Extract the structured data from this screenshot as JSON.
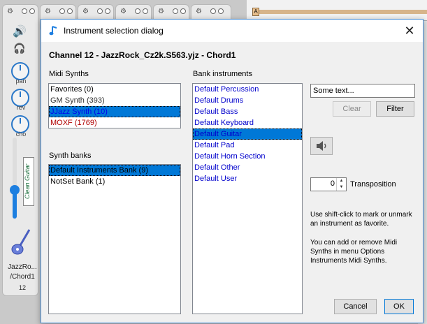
{
  "background": {
    "strip": {
      "pan_label": "pan",
      "rev_label": "rev",
      "cho_label": "cho",
      "vertical_label": "Clean Guitar",
      "name_line1": "JazzRo...",
      "name_line2": "/Chord1",
      "channel_number": "12"
    },
    "ruler_marker": "A"
  },
  "dialog": {
    "title": "Instrument selection dialog",
    "heading": "Channel 12 - JazzRock_Cz2k.S563.yjz - Chord1",
    "midi_synths_label": "Midi Synths",
    "midi_synths": [
      {
        "label": "Favorites (0)",
        "color": "#000000",
        "selected": false
      },
      {
        "label": "GM Synth (393)",
        "color": "#333333",
        "selected": false
      },
      {
        "label": "JJazz Synth (10)",
        "color": "#0000ee",
        "selected": true
      },
      {
        "label": "MOXF (1769)",
        "color": "#b00000",
        "selected": false
      }
    ],
    "synth_banks_label": "Synth banks",
    "synth_banks": [
      {
        "label": "Default Instruments Bank (9)",
        "selected": true
      },
      {
        "label": "NotSet Bank (1)",
        "selected": false
      }
    ],
    "bank_instruments_label": "Bank instruments",
    "bank_instruments": [
      {
        "label": "Default Percussion",
        "selected": false
      },
      {
        "label": "Default Drums",
        "selected": false
      },
      {
        "label": "Default Bass",
        "selected": false
      },
      {
        "label": "Default Keyboard",
        "selected": false
      },
      {
        "label": "Default Guitar",
        "selected": true
      },
      {
        "label": "Default Pad",
        "selected": false
      },
      {
        "label": "Default Horn Section",
        "selected": false
      },
      {
        "label": "Default Other",
        "selected": false
      },
      {
        "label": "Default User",
        "selected": false
      }
    ],
    "instrument_color": "#0000cc",
    "selection_color": "#0078d7",
    "search_value": "Some text...",
    "clear_label": "Clear",
    "filter_label": "Filter",
    "transposition_value": "0",
    "transposition_label": "Transposition",
    "help_text_1": "Use shift-click to mark or unmark an instrument as favorite.",
    "help_text_2": "You can add or remove Midi Synths in menu Options Instruments Midi Synths.",
    "cancel_label": "Cancel",
    "ok_label": "OK"
  }
}
